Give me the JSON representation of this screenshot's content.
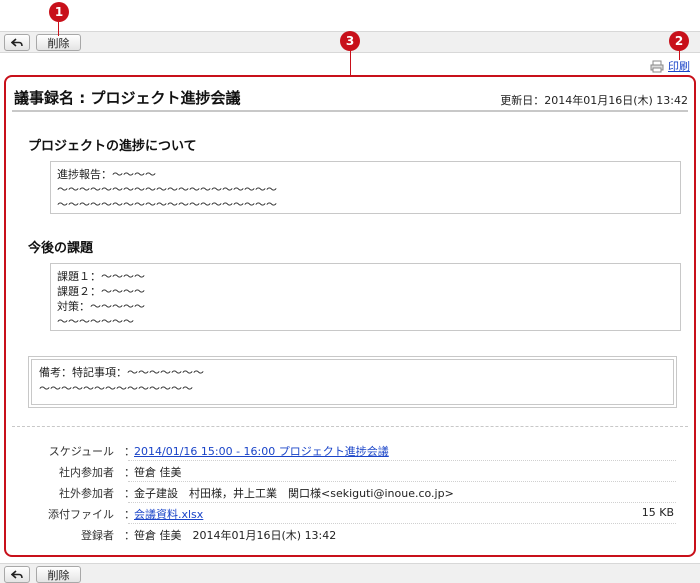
{
  "toolbar": {
    "delete_label": "削除"
  },
  "markers": [
    "1",
    "2",
    "3"
  ],
  "print_label": "印刷",
  "title": "議事録名 : プロジェクト進捗会議",
  "updated": "更新日：2014年01月16日(木) 13:42",
  "section1": {
    "heading": "プロジェクトの進捗について",
    "lines": [
      "進捗報告：〜〜〜〜",
      "〜〜〜〜〜〜〜〜〜〜〜〜〜〜〜〜〜〜〜〜",
      "〜〜〜〜〜〜〜〜〜〜〜〜〜〜〜〜〜〜〜〜"
    ]
  },
  "section2": {
    "heading": "今後の課題",
    "lines": [
      "課題１：〜〜〜〜",
      "課題２：〜〜〜〜",
      "対策：〜〜〜〜〜",
      "〜〜〜〜〜〜〜"
    ]
  },
  "note": {
    "lines": [
      "備考：特記事項：〜〜〜〜〜〜〜",
      "〜〜〜〜〜〜〜〜〜〜〜〜〜〜"
    ]
  },
  "colon": "：",
  "props": {
    "schedule_label": "スケジュール",
    "schedule_value": "2014/01/16 15:00 - 16:00 プロジェクト進捗会議",
    "internal_label": "社内参加者",
    "internal_value": "笹倉 佳美",
    "external_label": "社外参加者",
    "external_value": "金子建設　村田様，井上工業　関口様<sekiguti@inoue.co.jp>",
    "attachment_label": "添付ファイル",
    "attachment_value": "会議資料.xlsx",
    "attachment_size": "15 KB",
    "registrant_label": "登録者",
    "registrant_value": "笹倉 佳美　2014年01月16日(木) 13:42"
  }
}
